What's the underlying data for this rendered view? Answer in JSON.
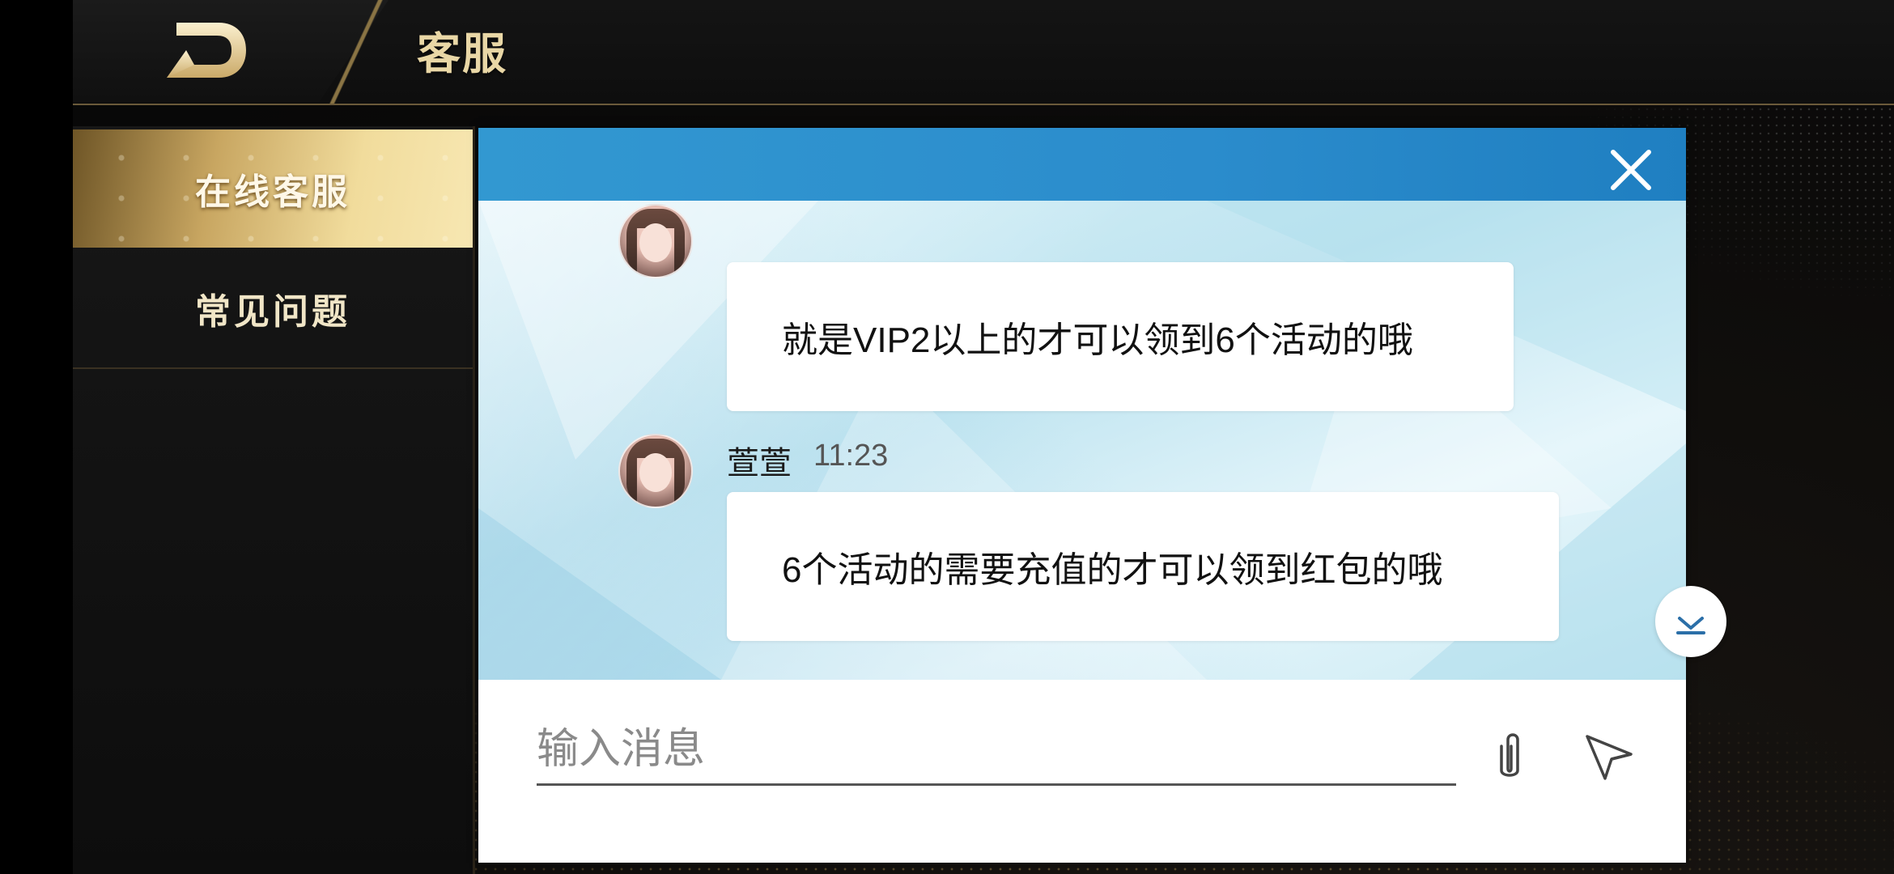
{
  "header": {
    "back_icon": "back-arrow-icon",
    "title": "客服"
  },
  "sidebar": {
    "items": [
      {
        "label": "在线客服",
        "active": true
      },
      {
        "label": "常见问题",
        "active": false
      }
    ]
  },
  "chat": {
    "close_icon": "close-icon",
    "messages": [
      {
        "text": "就是VIP2以上的才可以领到6个活动的哦"
      },
      {
        "sender": "萱萱",
        "time": "11:23",
        "text": "6个活动的需要充值的才可以领到红包的哦"
      }
    ],
    "scroll_down_icon": "chevron-down-icon"
  },
  "composer": {
    "placeholder": "输入消息",
    "attach_icon": "paperclip-icon",
    "send_icon": "send-icon"
  },
  "colors": {
    "header_blue": "#2b8ccc",
    "gold": "#e9d7a6",
    "active_tab": "#c8a661"
  }
}
